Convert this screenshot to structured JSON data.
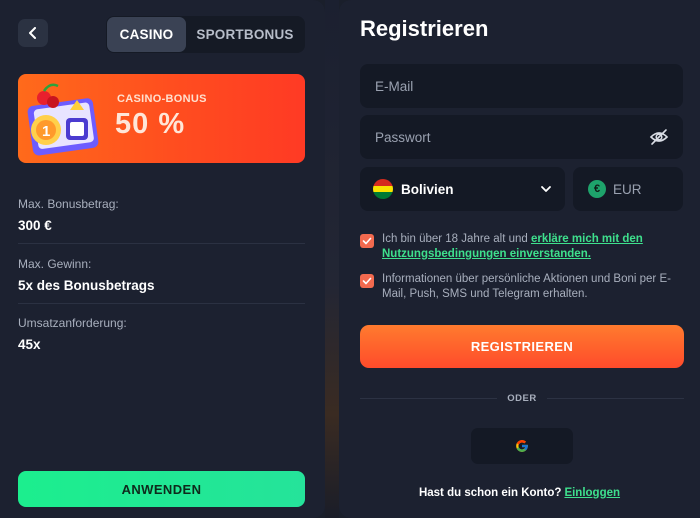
{
  "left_panel": {
    "tabs": [
      {
        "label": "CASINO",
        "active": true
      },
      {
        "label": "SPORTBONUS",
        "active": false
      }
    ],
    "banner": {
      "label": "CASINO-BONUS",
      "value": "50 %"
    },
    "info": [
      {
        "label": "Max. Bonusbetrag:",
        "value": "300 €"
      },
      {
        "label": "Max. Gewinn:",
        "value": "5x des Bonusbetrags"
      },
      {
        "label": "Umsatzanforderung:",
        "value": "45x"
      }
    ],
    "apply_label": "ANWENDEN"
  },
  "right_panel": {
    "title": "Registrieren",
    "email_placeholder": "E-Mail",
    "password_placeholder": "Passwort",
    "country": "Bolivien",
    "currency": "EUR",
    "currency_symbol": "€",
    "consent_age_prefix": "Ich bin über 18 Jahre alt und ",
    "consent_age_link": "erkläre mich mit den Nutzungsbedingungen einverstanden.",
    "consent_marketing": "Informationen über persönliche Aktionen und Boni per E-Mail, Push, SMS und Telegram erhalten.",
    "register_label": "REGISTRIEREN",
    "or_label": "ODER",
    "login_prompt": "Hast du schon ein Konto?",
    "login_link": "Einloggen"
  },
  "colors": {
    "accent_orange": "#ff5a24",
    "accent_green": "#1cee8e",
    "panel_bg": "#1c2130",
    "field_bg": "#141925"
  },
  "icons": [
    "back-arrow-icon",
    "eye-slash-icon",
    "chevron-down-icon",
    "bolivia-flag-icon",
    "euro-icon",
    "google-icon",
    "check-icon",
    "casino-bonus-illustration"
  ]
}
